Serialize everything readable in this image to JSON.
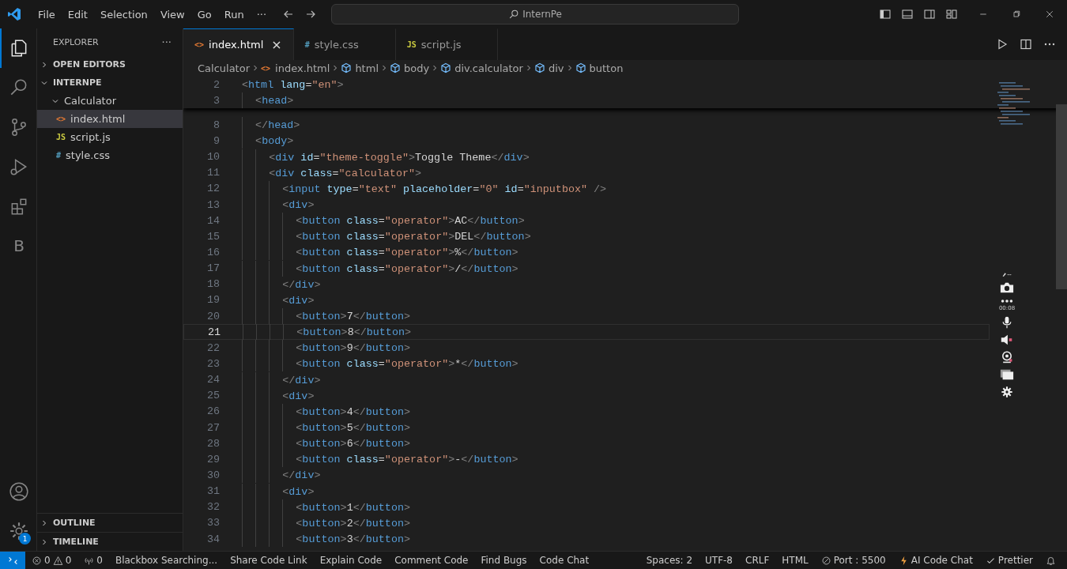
{
  "title_bar": {
    "menu": [
      "File",
      "Edit",
      "Selection",
      "View",
      "Go",
      "Run",
      "···"
    ],
    "search": {
      "value": "InternPe"
    }
  },
  "activity_bar": {
    "items": [
      {
        "kind": "explorer",
        "selected": true
      },
      {
        "kind": "search",
        "selected": false
      },
      {
        "kind": "source-control",
        "selected": false
      },
      {
        "kind": "run",
        "selected": false
      },
      {
        "kind": "extensions",
        "selected": false
      },
      {
        "kind": "letter",
        "text": "B",
        "selected": false
      }
    ],
    "settings_badge": "1"
  },
  "sidebar": {
    "title": "EXPLORER",
    "more": "···",
    "sections": [
      {
        "label": "OPEN EDITORS",
        "expanded": false
      },
      {
        "label": "INTERNPE",
        "expanded": true
      }
    ],
    "tree": [
      {
        "label": "Calculator",
        "expanded": true,
        "children": [
          {
            "label": "index.html",
            "icon": "<>",
            "kind": "html",
            "selected": true
          },
          {
            "label": "script.js",
            "icon": "JS",
            "kind": "js",
            "selected": false
          },
          {
            "label": "style.css",
            "icon": "#",
            "kind": "css",
            "selected": false
          }
        ]
      }
    ],
    "bottom_sections": [
      {
        "label": "OUTLINE",
        "expanded": false
      },
      {
        "label": "TIMELINE",
        "expanded": false
      }
    ]
  },
  "tabs": [
    {
      "label": "index.html",
      "icon": "<>",
      "kind": "html",
      "selected": true,
      "close": "×"
    },
    {
      "label": "style.css",
      "icon": "#",
      "kind": "css",
      "selected": false
    },
    {
      "label": "script.js",
      "icon": "JS",
      "kind": "js",
      "selected": false
    }
  ],
  "breadcrumb": [
    {
      "label": "Calculator",
      "kind": "folder"
    },
    {
      "label": "index.html",
      "kind": "file",
      "icon": "<>"
    },
    {
      "label": "html",
      "kind": "element"
    },
    {
      "label": "body",
      "kind": "element"
    },
    {
      "label": "div.calculator",
      "kind": "element"
    },
    {
      "label": "div",
      "kind": "element"
    },
    {
      "label": "button",
      "kind": "element"
    }
  ],
  "sticky_lines": [
    {
      "n": "2",
      "tokens": [
        {
          "kind": "punct",
          "text": "<"
        },
        {
          "kind": "tag",
          "text": "html"
        },
        {
          "kind": "attr",
          "text": " lang"
        },
        {
          "kind": "text",
          "text": "="
        },
        {
          "kind": "string",
          "text": "\"en\""
        },
        {
          "kind": "punct",
          "text": ">"
        }
      ]
    },
    {
      "n": "3",
      "tokens": [
        {
          "kind": "punct",
          "text": "  <"
        },
        {
          "kind": "tag",
          "text": "head"
        },
        {
          "kind": "punct",
          "text": ">"
        }
      ]
    }
  ],
  "code_lines": [
    {
      "n": "8",
      "current": false,
      "tokens": [
        {
          "kind": "punct",
          "text": "  </"
        },
        {
          "kind": "tag",
          "text": "head"
        },
        {
          "kind": "punct",
          "text": ">"
        }
      ]
    },
    {
      "n": "9",
      "current": false,
      "tokens": [
        {
          "kind": "punct",
          "text": "  <"
        },
        {
          "kind": "tag",
          "text": "body"
        },
        {
          "kind": "punct",
          "text": ">"
        }
      ]
    },
    {
      "n": "10",
      "current": false,
      "tokens": [
        {
          "kind": "punct",
          "text": "    <"
        },
        {
          "kind": "tag",
          "text": "div"
        },
        {
          "kind": "attr",
          "text": " id"
        },
        {
          "kind": "text",
          "text": "="
        },
        {
          "kind": "string",
          "text": "\"theme-toggle\""
        },
        {
          "kind": "punct",
          "text": ">"
        },
        {
          "kind": "text",
          "text": "Toggle Theme"
        },
        {
          "kind": "punct",
          "text": "</"
        },
        {
          "kind": "tag",
          "text": "div"
        },
        {
          "kind": "punct",
          "text": ">"
        }
      ]
    },
    {
      "n": "11",
      "current": false,
      "tokens": [
        {
          "kind": "punct",
          "text": "    <"
        },
        {
          "kind": "tag",
          "text": "div"
        },
        {
          "kind": "attr",
          "text": " class"
        },
        {
          "kind": "text",
          "text": "="
        },
        {
          "kind": "string",
          "text": "\"calculator\""
        },
        {
          "kind": "punct",
          "text": ">"
        }
      ]
    },
    {
      "n": "12",
      "current": false,
      "tokens": [
        {
          "kind": "punct",
          "text": "      <"
        },
        {
          "kind": "tag",
          "text": "input"
        },
        {
          "kind": "attr",
          "text": " type"
        },
        {
          "kind": "text",
          "text": "="
        },
        {
          "kind": "string",
          "text": "\"text\""
        },
        {
          "kind": "attr",
          "text": " placeholder"
        },
        {
          "kind": "text",
          "text": "="
        },
        {
          "kind": "string",
          "text": "\"0\""
        },
        {
          "kind": "attr",
          "text": " id"
        },
        {
          "kind": "text",
          "text": "="
        },
        {
          "kind": "string",
          "text": "\"inputbox\""
        },
        {
          "kind": "punct",
          "text": " />"
        }
      ]
    },
    {
      "n": "13",
      "current": false,
      "tokens": [
        {
          "kind": "punct",
          "text": "      <"
        },
        {
          "kind": "tag",
          "text": "div"
        },
        {
          "kind": "punct",
          "text": ">"
        }
      ]
    },
    {
      "n": "14",
      "current": false,
      "tokens": [
        {
          "kind": "punct",
          "text": "        <"
        },
        {
          "kind": "tag",
          "text": "button"
        },
        {
          "kind": "attr",
          "text": " class"
        },
        {
          "kind": "text",
          "text": "="
        },
        {
          "kind": "string",
          "text": "\"operator\""
        },
        {
          "kind": "punct",
          "text": ">"
        },
        {
          "kind": "text",
          "text": "AC"
        },
        {
          "kind": "punct",
          "text": "</"
        },
        {
          "kind": "tag",
          "text": "button"
        },
        {
          "kind": "punct",
          "text": ">"
        }
      ]
    },
    {
      "n": "15",
      "current": false,
      "tokens": [
        {
          "kind": "punct",
          "text": "        <"
        },
        {
          "kind": "tag",
          "text": "button"
        },
        {
          "kind": "attr",
          "text": " class"
        },
        {
          "kind": "text",
          "text": "="
        },
        {
          "kind": "string",
          "text": "\"operator\""
        },
        {
          "kind": "punct",
          "text": ">"
        },
        {
          "kind": "text",
          "text": "DEL"
        },
        {
          "kind": "punct",
          "text": "</"
        },
        {
          "kind": "tag",
          "text": "button"
        },
        {
          "kind": "punct",
          "text": ">"
        }
      ]
    },
    {
      "n": "16",
      "current": false,
      "tokens": [
        {
          "kind": "punct",
          "text": "        <"
        },
        {
          "kind": "tag",
          "text": "button"
        },
        {
          "kind": "attr",
          "text": " class"
        },
        {
          "kind": "text",
          "text": "="
        },
        {
          "kind": "string",
          "text": "\"operator\""
        },
        {
          "kind": "punct",
          "text": ">"
        },
        {
          "kind": "text",
          "text": "%"
        },
        {
          "kind": "punct",
          "text": "</"
        },
        {
          "kind": "tag",
          "text": "button"
        },
        {
          "kind": "punct",
          "text": ">"
        }
      ]
    },
    {
      "n": "17",
      "current": false,
      "tokens": [
        {
          "kind": "punct",
          "text": "        <"
        },
        {
          "kind": "tag",
          "text": "button"
        },
        {
          "kind": "attr",
          "text": " class"
        },
        {
          "kind": "text",
          "text": "="
        },
        {
          "kind": "string",
          "text": "\"operator\""
        },
        {
          "kind": "punct",
          "text": ">"
        },
        {
          "kind": "text",
          "text": "/"
        },
        {
          "kind": "punct",
          "text": "</"
        },
        {
          "kind": "tag",
          "text": "button"
        },
        {
          "kind": "punct",
          "text": ">"
        }
      ]
    },
    {
      "n": "18",
      "current": false,
      "tokens": [
        {
          "kind": "punct",
          "text": "      </"
        },
        {
          "kind": "tag",
          "text": "div"
        },
        {
          "kind": "punct",
          "text": ">"
        }
      ]
    },
    {
      "n": "19",
      "current": false,
      "tokens": [
        {
          "kind": "punct",
          "text": "      <"
        },
        {
          "kind": "tag",
          "text": "div"
        },
        {
          "kind": "punct",
          "text": ">"
        }
      ]
    },
    {
      "n": "20",
      "current": false,
      "tokens": [
        {
          "kind": "punct",
          "text": "        <"
        },
        {
          "kind": "tag",
          "text": "button"
        },
        {
          "kind": "punct",
          "text": ">"
        },
        {
          "kind": "text",
          "text": "7"
        },
        {
          "kind": "punct",
          "text": "</"
        },
        {
          "kind": "tag",
          "text": "button"
        },
        {
          "kind": "punct",
          "text": ">"
        }
      ]
    },
    {
      "n": "21",
      "current": true,
      "tokens": [
        {
          "kind": "punct",
          "text": "        <"
        },
        {
          "kind": "tag",
          "text": "button"
        },
        {
          "kind": "punct",
          "text": ">"
        },
        {
          "kind": "text",
          "text": "8"
        },
        {
          "kind": "punct",
          "text": "</"
        },
        {
          "kind": "tag",
          "text": "button"
        },
        {
          "kind": "punct",
          "text": ">"
        }
      ]
    },
    {
      "n": "22",
      "current": false,
      "tokens": [
        {
          "kind": "punct",
          "text": "        <"
        },
        {
          "kind": "tag",
          "text": "button"
        },
        {
          "kind": "punct",
          "text": ">"
        },
        {
          "kind": "text",
          "text": "9"
        },
        {
          "kind": "punct",
          "text": "</"
        },
        {
          "kind": "tag",
          "text": "button"
        },
        {
          "kind": "punct",
          "text": ">"
        }
      ]
    },
    {
      "n": "23",
      "current": false,
      "tokens": [
        {
          "kind": "punct",
          "text": "        <"
        },
        {
          "kind": "tag",
          "text": "button"
        },
        {
          "kind": "attr",
          "text": " class"
        },
        {
          "kind": "text",
          "text": "="
        },
        {
          "kind": "string",
          "text": "\"operator\""
        },
        {
          "kind": "punct",
          "text": ">"
        },
        {
          "kind": "text",
          "text": "*"
        },
        {
          "kind": "punct",
          "text": "</"
        },
        {
          "kind": "tag",
          "text": "button"
        },
        {
          "kind": "punct",
          "text": ">"
        }
      ]
    },
    {
      "n": "24",
      "current": false,
      "tokens": [
        {
          "kind": "punct",
          "text": "      </"
        },
        {
          "kind": "tag",
          "text": "div"
        },
        {
          "kind": "punct",
          "text": ">"
        }
      ]
    },
    {
      "n": "25",
      "current": false,
      "tokens": [
        {
          "kind": "punct",
          "text": "      <"
        },
        {
          "kind": "tag",
          "text": "div"
        },
        {
          "kind": "punct",
          "text": ">"
        }
      ]
    },
    {
      "n": "26",
      "current": false,
      "tokens": [
        {
          "kind": "punct",
          "text": "        <"
        },
        {
          "kind": "tag",
          "text": "button"
        },
        {
          "kind": "punct",
          "text": ">"
        },
        {
          "kind": "text",
          "text": "4"
        },
        {
          "kind": "punct",
          "text": "</"
        },
        {
          "kind": "tag",
          "text": "button"
        },
        {
          "kind": "punct",
          "text": ">"
        }
      ]
    },
    {
      "n": "27",
      "current": false,
      "tokens": [
        {
          "kind": "punct",
          "text": "        <"
        },
        {
          "kind": "tag",
          "text": "button"
        },
        {
          "kind": "punct",
          "text": ">"
        },
        {
          "kind": "text",
          "text": "5"
        },
        {
          "kind": "punct",
          "text": "</"
        },
        {
          "kind": "tag",
          "text": "button"
        },
        {
          "kind": "punct",
          "text": ">"
        }
      ]
    },
    {
      "n": "28",
      "current": false,
      "tokens": [
        {
          "kind": "punct",
          "text": "        <"
        },
        {
          "kind": "tag",
          "text": "button"
        },
        {
          "kind": "punct",
          "text": ">"
        },
        {
          "kind": "text",
          "text": "6"
        },
        {
          "kind": "punct",
          "text": "</"
        },
        {
          "kind": "tag",
          "text": "button"
        },
        {
          "kind": "punct",
          "text": ">"
        }
      ]
    },
    {
      "n": "29",
      "current": false,
      "tokens": [
        {
          "kind": "punct",
          "text": "        <"
        },
        {
          "kind": "tag",
          "text": "button"
        },
        {
          "kind": "attr",
          "text": " class"
        },
        {
          "kind": "text",
          "text": "="
        },
        {
          "kind": "string",
          "text": "\"operator\""
        },
        {
          "kind": "punct",
          "text": ">"
        },
        {
          "kind": "text",
          "text": "-"
        },
        {
          "kind": "punct",
          "text": "</"
        },
        {
          "kind": "tag",
          "text": "button"
        },
        {
          "kind": "punct",
          "text": ">"
        }
      ]
    },
    {
      "n": "30",
      "current": false,
      "tokens": [
        {
          "kind": "punct",
          "text": "      </"
        },
        {
          "kind": "tag",
          "text": "div"
        },
        {
          "kind": "punct",
          "text": ">"
        }
      ]
    },
    {
      "n": "31",
      "current": false,
      "tokens": [
        {
          "kind": "punct",
          "text": "      <"
        },
        {
          "kind": "tag",
          "text": "div"
        },
        {
          "kind": "punct",
          "text": ">"
        }
      ]
    },
    {
      "n": "32",
      "current": false,
      "tokens": [
        {
          "kind": "punct",
          "text": "        <"
        },
        {
          "kind": "tag",
          "text": "button"
        },
        {
          "kind": "punct",
          "text": ">"
        },
        {
          "kind": "text",
          "text": "1"
        },
        {
          "kind": "punct",
          "text": "</"
        },
        {
          "kind": "tag",
          "text": "button"
        },
        {
          "kind": "punct",
          "text": ">"
        }
      ]
    },
    {
      "n": "33",
      "current": false,
      "tokens": [
        {
          "kind": "punct",
          "text": "        <"
        },
        {
          "kind": "tag",
          "text": "button"
        },
        {
          "kind": "punct",
          "text": ">"
        },
        {
          "kind": "text",
          "text": "2"
        },
        {
          "kind": "punct",
          "text": "</"
        },
        {
          "kind": "tag",
          "text": "button"
        },
        {
          "kind": "punct",
          "text": ">"
        }
      ]
    },
    {
      "n": "34",
      "current": false,
      "tokens": [
        {
          "kind": "punct",
          "text": "        <"
        },
        {
          "kind": "tag",
          "text": "button"
        },
        {
          "kind": "punct",
          "text": ">"
        },
        {
          "kind": "text",
          "text": "3"
        },
        {
          "kind": "punct",
          "text": "</"
        },
        {
          "kind": "tag",
          "text": "button"
        },
        {
          "kind": "punct",
          "text": ">"
        }
      ]
    }
  ],
  "recorder": {
    "timer": "00:08"
  },
  "status_bar": {
    "errors": "0",
    "warnings": "0",
    "ports": "0",
    "left": [
      "Blackbox Searching...",
      "Share Code Link",
      "Explain Code",
      "Comment Code",
      "Find Bugs",
      "Code Chat"
    ],
    "right": [
      {
        "label": "Spaces: 2",
        "kind": "plain"
      },
      {
        "label": "UTF-8",
        "kind": "plain"
      },
      {
        "label": "CRLF",
        "kind": "plain"
      },
      {
        "label": "HTML",
        "kind": "plain"
      },
      {
        "label": "Port : 5500",
        "kind": "port"
      },
      {
        "label": "AI Code Chat",
        "kind": "bolt"
      },
      {
        "label": "Prettier",
        "kind": "check"
      }
    ]
  }
}
